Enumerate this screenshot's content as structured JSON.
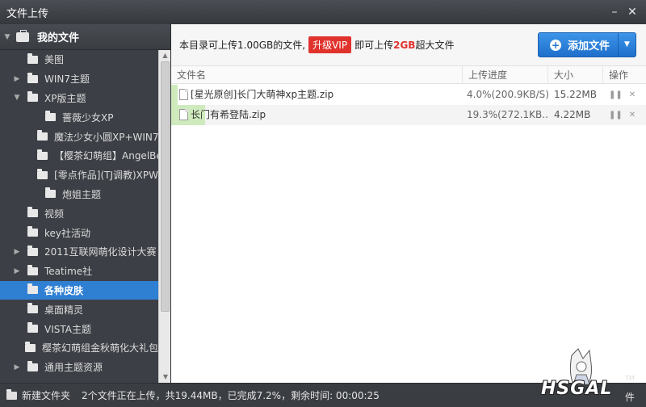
{
  "window": {
    "title": "文件上传",
    "min_glyph": "–",
    "close_glyph": "✕"
  },
  "sidebar": {
    "header": "我的文件",
    "items": [
      {
        "label": "美图",
        "level": 1,
        "arrow": ""
      },
      {
        "label": "WIN7主题",
        "level": 1,
        "arrow": "▶"
      },
      {
        "label": "XP版主题",
        "level": 1,
        "arrow": "▼"
      },
      {
        "label": "蔷薇少女XP",
        "level": 2,
        "arrow": ""
      },
      {
        "label": "魔法少女小圆XP+WIN7",
        "level": 2,
        "arrow": ""
      },
      {
        "label": "【樱茶幻萌组】AngelBe",
        "level": 2,
        "arrow": ""
      },
      {
        "label": "[零点作品](TJ调教)XPW",
        "level": 2,
        "arrow": ""
      },
      {
        "label": "炮姐主题",
        "level": 2,
        "arrow": ""
      },
      {
        "label": "视频",
        "level": 1,
        "arrow": ""
      },
      {
        "label": "key社活动",
        "level": 1,
        "arrow": ""
      },
      {
        "label": "2011互联网萌化设计大赛",
        "level": 1,
        "arrow": "▶"
      },
      {
        "label": "Teatime社",
        "level": 1,
        "arrow": "▶"
      },
      {
        "label": "各种皮肤",
        "level": 1,
        "arrow": "",
        "selected": true
      },
      {
        "label": "桌面精灵",
        "level": 1,
        "arrow": ""
      },
      {
        "label": "VISTA主题",
        "level": 1,
        "arrow": ""
      },
      {
        "label": "樱茶幻萌组金秋萌化大礼包",
        "level": 1,
        "arrow": ""
      },
      {
        "label": "通用主题资源",
        "level": 1,
        "arrow": "▶"
      }
    ]
  },
  "infobar": {
    "text_pre": "本目录可上传1.00GB的文件,",
    "upgrade_label": "升级VIP",
    "text_mid": "即可上传",
    "highlight": "2GB",
    "text_post": "超大文件"
  },
  "add_button": {
    "label": "添加文件",
    "dropdown_glyph": "▼"
  },
  "table": {
    "headers": {
      "name": "文件名",
      "progress": "上传进度",
      "size": "大小",
      "ops": "操作"
    },
    "rows": [
      {
        "name": "[星光原创]长门大萌神xp主题.zip",
        "progress": "4.0%(200.9KB/S)",
        "progress_pct": 4.0,
        "size": "15.22MB",
        "pause": "❚❚",
        "remove": "✕"
      },
      {
        "name": "长门有希登陆.zip",
        "progress": "19.3%(272.1KB...",
        "progress_pct": 19.3,
        "size": "4.22MB",
        "pause": "❚❚",
        "remove": "✕"
      }
    ]
  },
  "statusbar": {
    "new_folder": "新建文件夹",
    "status": "2个文件正在上传，共19.44MB，已完成7.2%，剩余时间: 00:00:25",
    "tail": "件"
  },
  "logo": {
    "text": "HSGAL",
    "tm": "TM"
  },
  "colors": {
    "accent": "#2f7fd3",
    "vip_red": "#e0332d",
    "progress_green": "#cfeabd"
  }
}
